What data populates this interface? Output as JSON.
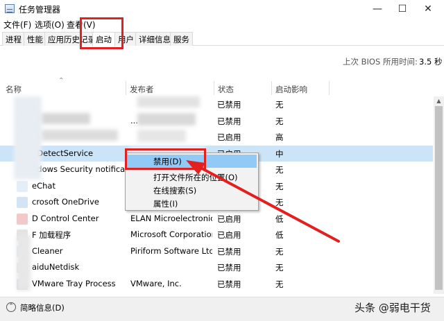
{
  "window": {
    "title": "任务管理器",
    "minimize": "—",
    "maximize": "☐",
    "close": "✕"
  },
  "menu": [
    "文件(F)",
    "选项(O)",
    "查看(V)"
  ],
  "tabs": [
    "进程",
    "性能",
    "应用历史记录",
    "启动",
    "用户",
    "详细信息",
    "服务"
  ],
  "active_tab": "启动",
  "bios": {
    "label": "上次 BIOS 所用时间:",
    "value": "3.5 秒"
  },
  "columns": {
    "name": "名称",
    "publisher": "发布者",
    "status": "状态",
    "impact": "启动影响"
  },
  "rows": [
    {
      "name": "",
      "publisher": "",
      "status": "已禁用",
      "impact": "无"
    },
    {
      "name": "",
      "publisher": "...",
      "status": "已禁用",
      "impact": "无"
    },
    {
      "name": "",
      "publisher": "",
      "status": "已启用",
      "impact": "高"
    },
    {
      "name": "nDetectService",
      "publisher": "",
      "status": "已启用",
      "impact": "中"
    },
    {
      "name": "ndows Security notifica...",
      "publisher": "",
      "status": "已启用",
      "impact": "无"
    },
    {
      "name": "eChat",
      "publisher": "T",
      "status": "已禁用",
      "impact": "无"
    },
    {
      "name": "crosoft OneDrive",
      "publisher": "M",
      "status": "已禁用",
      "impact": "无"
    },
    {
      "name": "D Control Center",
      "publisher": "ELAN Microelectronic...",
      "status": "已启用",
      "impact": "低"
    },
    {
      "name": "F 加载程序",
      "publisher": "Microsoft Corporation",
      "status": "已启用",
      "impact": "低"
    },
    {
      "name": "Cleaner",
      "publisher": "Piriform Software Ltd",
      "status": "已禁用",
      "impact": "无"
    },
    {
      "name": "aiduNetdisk",
      "publisher": "",
      "status": "已禁用",
      "impact": "无"
    },
    {
      "name": "VMware Tray Process",
      "publisher": "VMware, Inc.",
      "status": "已禁用",
      "impact": "无"
    }
  ],
  "selected_row_index": 3,
  "context_menu": [
    "禁用(D)",
    "打开文件所在的位置(O)",
    "在线搜索(S)",
    "属性(I)"
  ],
  "footer": {
    "label": "简略信息(D)",
    "watermark": "头条 @弱电干货"
  },
  "colors": {
    "annotation": "#e2201f",
    "selection": "#cce4f7",
    "menu_highlight": "#91c9f7"
  },
  "icons": [
    "task-manager-icon",
    "chevron-up-icon",
    "collapse-icon"
  ]
}
